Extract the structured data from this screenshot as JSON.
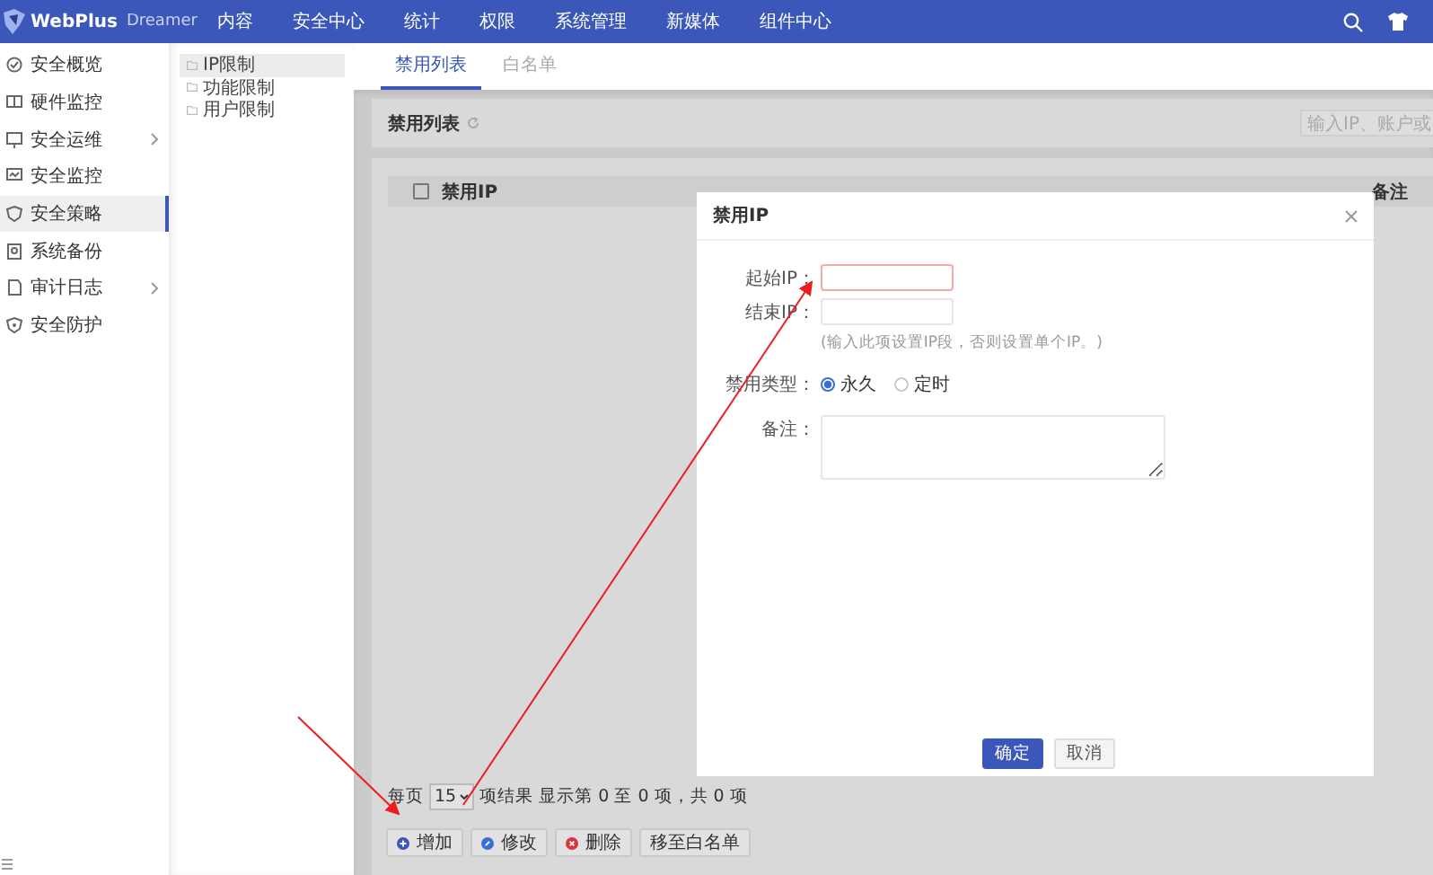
{
  "topbar": {
    "brand": "WebPlus",
    "brand_sub": "Dreamer",
    "menu": [
      "内容",
      "安全中心",
      "统计",
      "权限",
      "系统管理",
      "新媒体",
      "组件中心"
    ]
  },
  "sidebar": {
    "items": [
      {
        "label": "安全概览",
        "selected": false,
        "has_submenu": false
      },
      {
        "label": "硬件监控",
        "selected": false,
        "has_submenu": false
      },
      {
        "label": "安全运维",
        "selected": false,
        "has_submenu": true
      },
      {
        "label": "安全监控",
        "selected": false,
        "has_submenu": false
      },
      {
        "label": "安全策略",
        "selected": true,
        "has_submenu": false
      },
      {
        "label": "系统备份",
        "selected": false,
        "has_submenu": false
      },
      {
        "label": "审计日志",
        "selected": false,
        "has_submenu": true
      },
      {
        "label": "安全防护",
        "selected": false,
        "has_submenu": false
      }
    ]
  },
  "tree": {
    "items": [
      {
        "label": "IP限制",
        "selected": true
      },
      {
        "label": "功能限制",
        "selected": false
      },
      {
        "label": "用户限制",
        "selected": false
      }
    ]
  },
  "tabs": [
    {
      "label": "禁用列表",
      "selected": true
    },
    {
      "label": "白名单",
      "selected": false
    }
  ],
  "panel": {
    "title": "禁用列表",
    "search_placeholder": "输入IP、账户或"
  },
  "table": {
    "select_all_checked": false,
    "columns": [
      "禁用IP",
      "备注"
    ]
  },
  "pagination": {
    "prefix": "每页",
    "page_size": "15",
    "summary": "项结果 显示第 0 至 0 项，共 0 项"
  },
  "actions": [
    {
      "label": "增加",
      "kind": "add"
    },
    {
      "label": "修改",
      "kind": "edit"
    },
    {
      "label": "删除",
      "kind": "delete"
    },
    {
      "label": "移至白名单",
      "kind": "plain"
    }
  ],
  "modal": {
    "title": "禁用IP",
    "start_ip": {
      "label": "起始IP：",
      "invalid": true
    },
    "end_ip": {
      "label": "结束IP：",
      "invalid": false
    },
    "hint": "(输入此项设置IP段，否则设置单个IP。)",
    "type_label": "禁用类型：",
    "options": [
      {
        "label": "永久",
        "selected": true
      },
      {
        "label": "定时",
        "selected": false
      }
    ],
    "remark_label": "备注：",
    "buttons": [
      {
        "label": "确定",
        "kind": "primary"
      },
      {
        "label": "取消",
        "kind": "default"
      }
    ]
  }
}
